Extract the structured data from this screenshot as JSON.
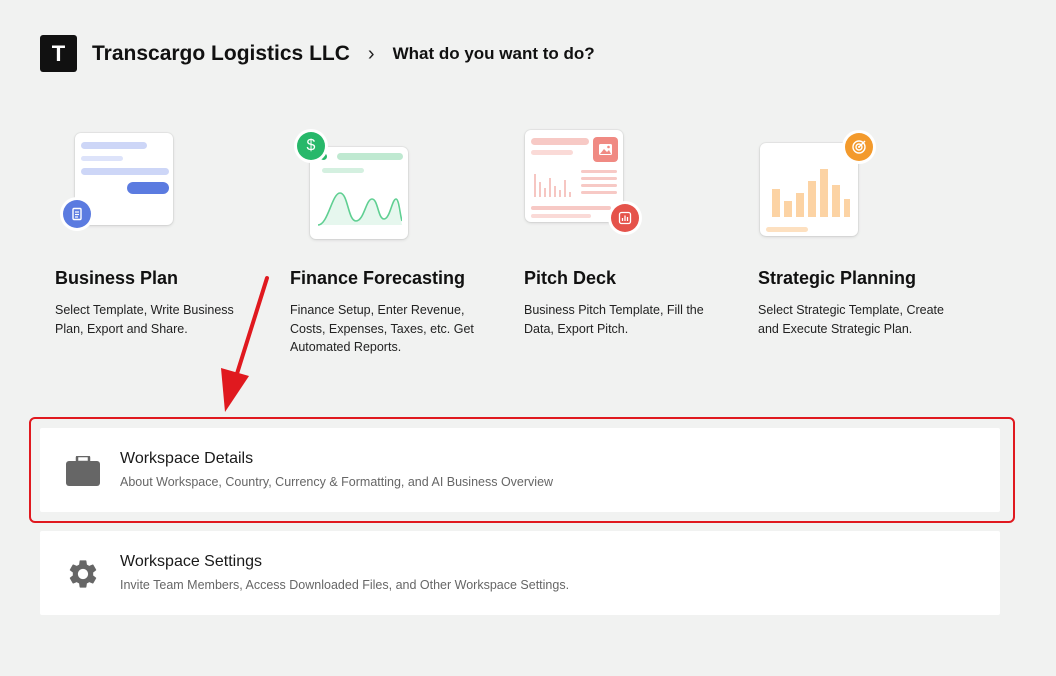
{
  "header": {
    "logo_letter": "T",
    "company": "Transcargo Logistics LLC",
    "separator": "›",
    "prompt": "What do you want to do?"
  },
  "cards": [
    {
      "title": "Business Plan",
      "desc": "Select Template, Write Business Plan, Export and Share.",
      "badge_icon": "document-icon",
      "accent": "#5b7be0"
    },
    {
      "title": "Finance Forecasting",
      "desc": "Finance Setup, Enter Revenue, Costs, Expenses, Taxes, etc. Get Automated Reports.",
      "badge_icon": "dollar-icon",
      "badge_glyph": "$",
      "accent": "#27b86a"
    },
    {
      "title": "Pitch Deck",
      "desc": "Business Pitch Template, Fill the Data, Export Pitch.",
      "badge_icon": "chart-icon",
      "accent": "#e5534b"
    },
    {
      "title": "Strategic Planning",
      "desc": "Select Strategic Template, Create and Execute Strategic Plan.",
      "badge_icon": "target-icon",
      "accent": "#f39a2c"
    }
  ],
  "workspace_details": {
    "title": "Workspace Details",
    "subtitle": "About Workspace, Country, Currency & Formatting, and AI Business Overview",
    "icon": "briefcase-icon"
  },
  "workspace_settings": {
    "title": "Workspace Settings",
    "subtitle": "Invite Team Members, Access Downloaded Files, and Other Workspace Settings.",
    "icon": "gear-icon"
  },
  "annotation": {
    "color": "#e0191f"
  }
}
